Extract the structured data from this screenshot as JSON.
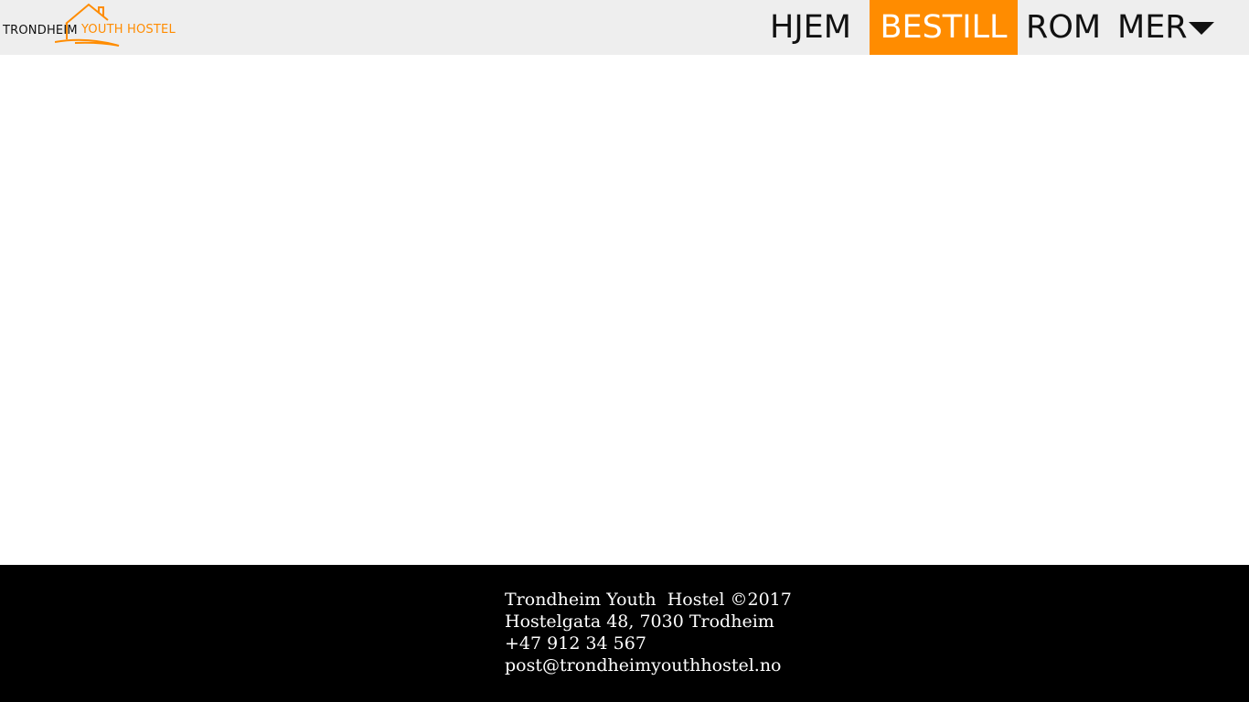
{
  "header": {
    "logo": {
      "text_part1": "TRONDHEIM",
      "text_part2": "YOUTH HOSTEL",
      "icon": "house-icon",
      "accent_color": "#ff8c00"
    },
    "nav": {
      "items": [
        {
          "label": "HJEM",
          "active": false
        },
        {
          "label": "BESTILL",
          "active": true
        },
        {
          "label": "ROM",
          "active": false
        },
        {
          "label": "MER",
          "active": false,
          "icon": "caret-down-icon"
        }
      ]
    },
    "background_color": "#eeeeee",
    "active_color": "#ff8c00"
  },
  "footer": {
    "lines": [
      "Trondheim Youth  Hostel ©2017",
      "Hostelgata 48, 7030 Trodheim",
      "+47 912 34 567",
      "post@trondheimyouthhostel.no"
    ],
    "background_color": "#000000",
    "text_color": "#ffffff"
  }
}
